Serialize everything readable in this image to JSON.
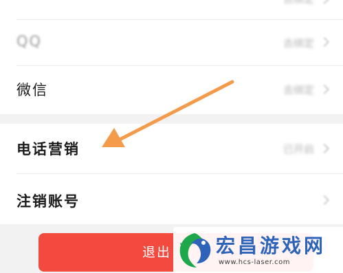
{
  "settings": {
    "rows": [
      {
        "label": "",
        "value": "去绑定"
      },
      {
        "label": "QQ",
        "value": "去绑定"
      },
      {
        "label": "微信",
        "value": "去绑定"
      },
      {
        "label": "电话营销",
        "value": "已开启"
      },
      {
        "label": "注销账号",
        "value": ""
      }
    ]
  },
  "logout": {
    "label": "退出"
  },
  "watermark": {
    "title": "宏昌游戏网",
    "url": "www.hcs-laser.com"
  },
  "colors": {
    "accent": "#f24a3f",
    "arrow": "#f39a4b",
    "brand_blue": "#2d63b8",
    "logo_green": "#1fa84b"
  }
}
